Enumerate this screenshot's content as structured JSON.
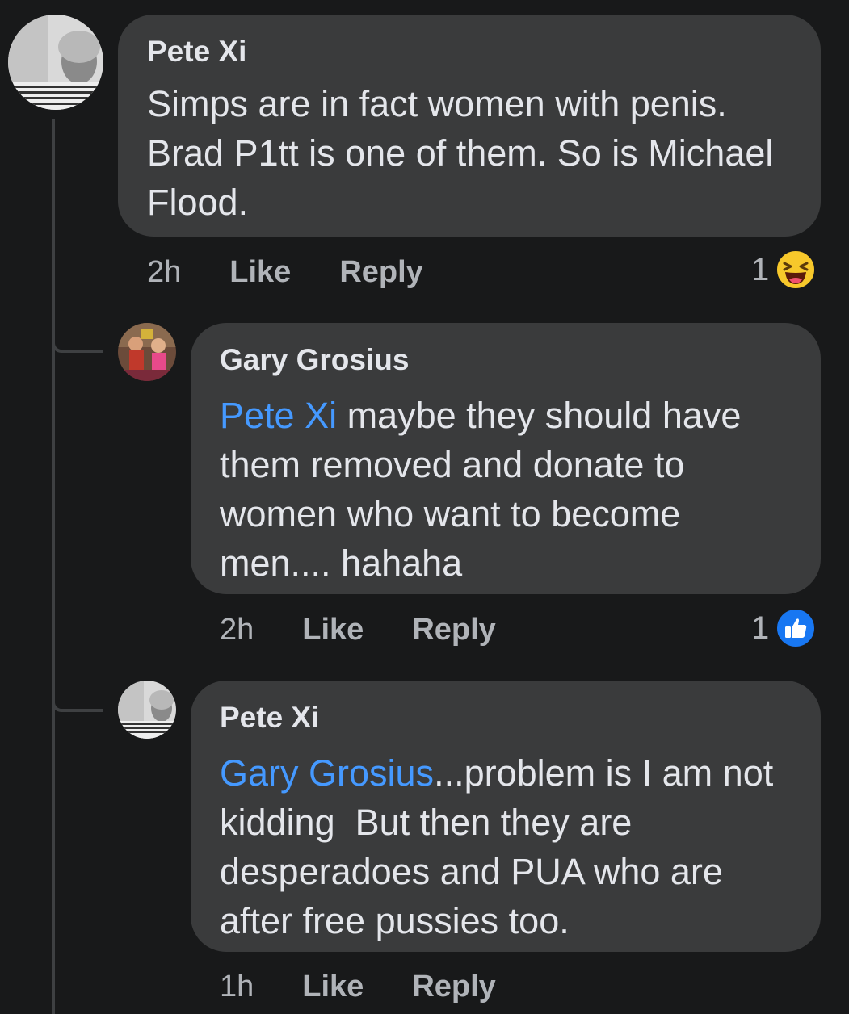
{
  "comments": [
    {
      "author": "Pete Xi",
      "mention": "",
      "text": "Simps are in fact women with penis. Brad P1tt is one of them. So is Michael Flood.",
      "time": "2h",
      "like_label": "Like",
      "reply_label": "Reply",
      "reaction": {
        "count": "1",
        "icon": "haha-emoji-icon"
      }
    },
    {
      "author": "Gary Grosius",
      "mention": "Pete Xi",
      "text": " maybe they should have them removed and donate to women who want to become men.... hahaha",
      "time": "2h",
      "like_label": "Like",
      "reply_label": "Reply",
      "reaction": {
        "count": "1",
        "icon": "thumbs-up-icon"
      }
    },
    {
      "author": "Pete Xi",
      "mention": "Gary Grosius",
      "text": "...problem is I am not kidding  But then they are desperadoes and PUA who are after free pussies too.",
      "time": "1h",
      "like_label": "Like",
      "reply_label": "Reply"
    }
  ],
  "colors": {
    "background": "#18191a",
    "bubble": "#3a3b3c",
    "text": "#e4e6eb",
    "secondary_text": "#b0b3b8",
    "mention": "#4599ff",
    "like_blue": "#1877f2",
    "haha_yellow": "#f7c82b"
  }
}
